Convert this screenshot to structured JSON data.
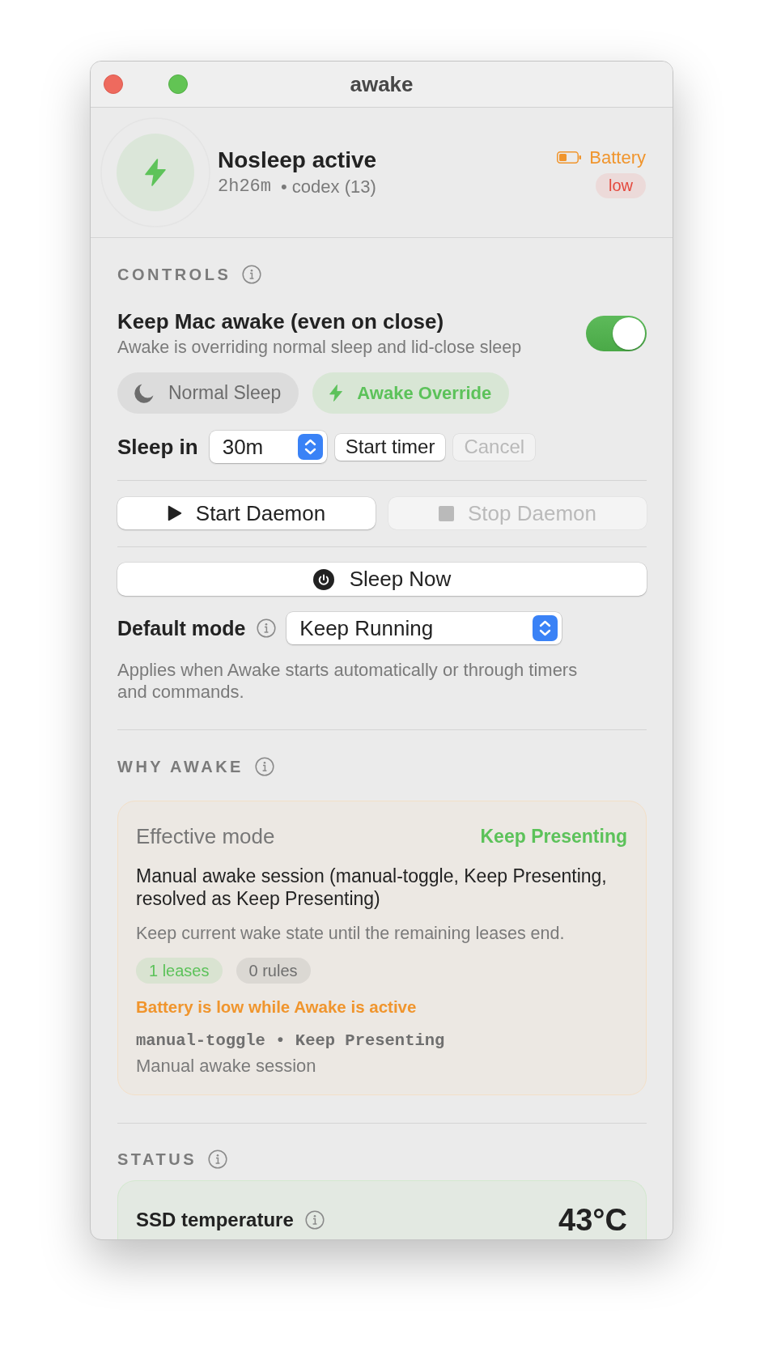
{
  "window": {
    "title": "awake"
  },
  "header": {
    "title": "Nosleep active",
    "duration": "2h26m",
    "detail": "• codex (13)",
    "power": {
      "source": "Battery",
      "badge": "low"
    }
  },
  "controls": {
    "heading": "CONTROLS",
    "toggle": {
      "label": "Keep Mac awake (even on close)",
      "description": "Awake is overriding normal sleep and lid-close sleep",
      "on": true
    },
    "modes": [
      {
        "kind": "sleep",
        "label": "Normal Sleep",
        "selected": false
      },
      {
        "kind": "awake",
        "label": "Awake Override",
        "selected": true
      }
    ],
    "timer": {
      "label": "Sleep in",
      "value": "30m",
      "start": {
        "label": "Start timer",
        "disabled": false
      },
      "cancel": {
        "label": "Cancel",
        "disabled": true
      }
    },
    "daemon": [
      {
        "kind": "start",
        "label": "Start Daemon",
        "disabled": false
      },
      {
        "kind": "stop",
        "label": "Stop Daemon",
        "disabled": true
      }
    ],
    "sleep_now": {
      "label": "Sleep Now"
    },
    "default_mode": {
      "label": "Default mode",
      "value": "Keep Running"
    },
    "hint": "Applies when Awake starts automatically or through timers and commands."
  },
  "why_awake": {
    "heading": "WHY AWAKE",
    "label": "Effective mode",
    "value": "Keep Presenting",
    "reason": "Manual awake session (manual-toggle, Keep Presenting, resolved as Keep Presenting)",
    "note": "Keep current wake state until the remaining leases end.",
    "chips": [
      {
        "label": "1 leases",
        "color": "#5cc25a"
      },
      {
        "label": "0 rules",
        "color": "#6e6e6e"
      }
    ],
    "warning": "Battery is low while Awake is active",
    "source": "manual-toggle • Keep Presenting",
    "source_description": "Manual awake session"
  },
  "status": {
    "heading": "STATUS",
    "items": [
      {
        "label": "SSD temperature",
        "value": "43°C"
      }
    ]
  }
}
